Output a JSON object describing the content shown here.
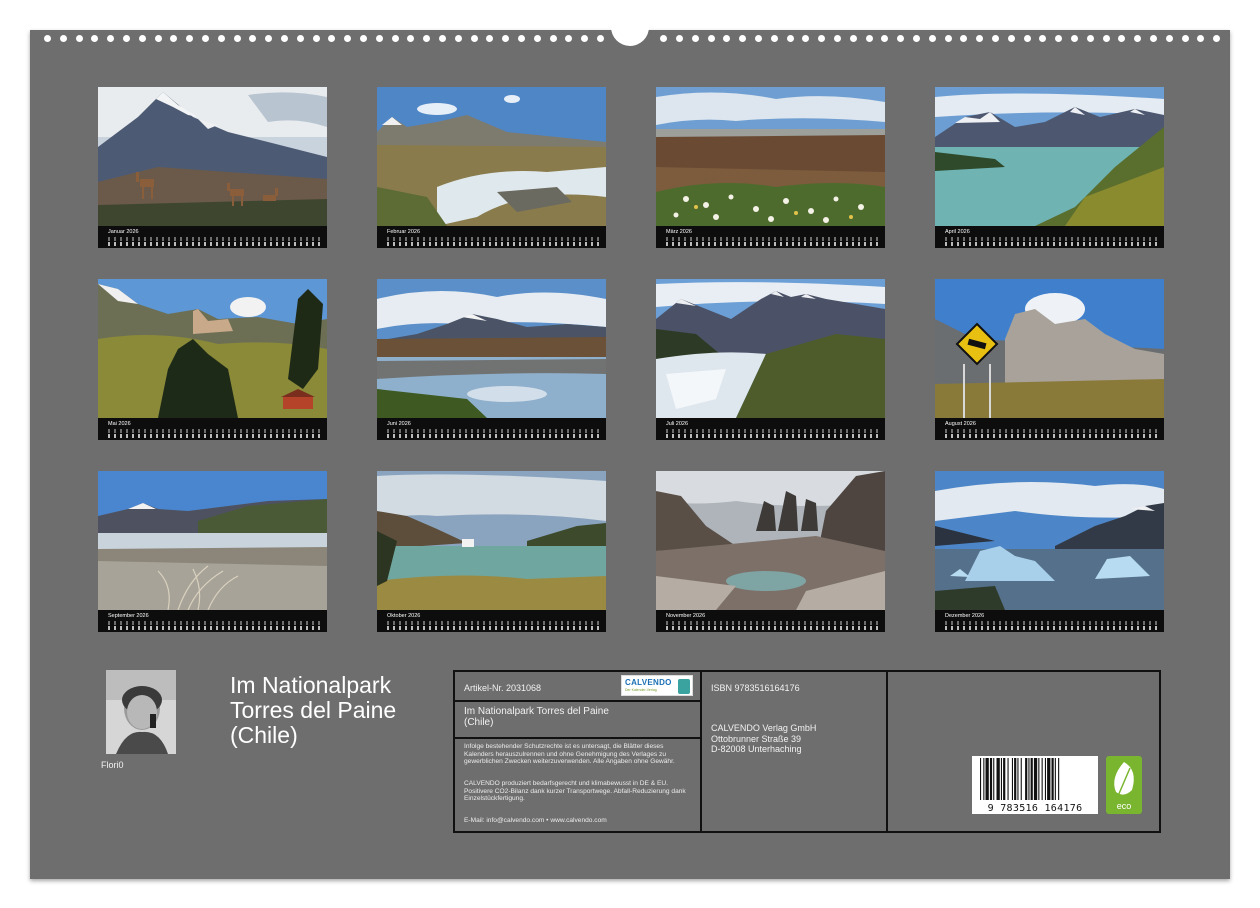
{
  "months": [
    {
      "name": "Januar 2026",
      "scene": "mountain-guanaco"
    },
    {
      "name": "Februar 2026",
      "scene": "waterfall"
    },
    {
      "name": "März 2026",
      "scene": "steppe-flowers"
    },
    {
      "name": "April 2026",
      "scene": "turquoise-lake"
    },
    {
      "name": "Mai 2026",
      "scene": "forest-hut"
    },
    {
      "name": "Juni 2026",
      "scene": "lake-reflection"
    },
    {
      "name": "Juli 2026",
      "scene": "rapids-towers"
    },
    {
      "name": "August 2026",
      "scene": "warning-sign"
    },
    {
      "name": "September 2026",
      "scene": "beach-grass"
    },
    {
      "name": "Oktober 2026",
      "scene": "green-lake"
    },
    {
      "name": "November 2026",
      "scene": "towers-lagoon"
    },
    {
      "name": "Dezember 2026",
      "scene": "icebergs"
    }
  ],
  "author": {
    "name": "Flori0"
  },
  "title": {
    "line1": "Im Nationalpark",
    "line2": "Torres del Paine",
    "line3": "(Chile)"
  },
  "info": {
    "article_no": "Artikel-Nr. 2031068",
    "logo_word": "CALVENDO",
    "logo_tagline": "Der Kalender-Verlag",
    "subtitle_1": "Im Nationalpark Torres del Paine",
    "subtitle_2": "(Chile)",
    "notice_1": "Infolge bestehender Schutzrechte ist es untersagt, die Blätter dieses Kalenders herauszulrennen und ohne Genehmigung des Verlages zu gewerblichen Zwecken weiterzuverwenden. Alle Angaben ohne Gewähr.",
    "notice_2": "CALVENDO produziert bedarfsgerecht und klimabewusst in DE & EU. Positivere CO2-Bilanz dank kurzer Transportwege. Abfall-Reduzierung dank Einzelstückfertigung.",
    "notice_3": "E-Mail: info@calvendo.com • www.calvendo.com",
    "isbn": "ISBN 9783516164176",
    "publisher_1": "CALVENDO Verlag GmbH",
    "publisher_2": "Ottobrunner Straße 39",
    "publisher_3": "D-82008 Unterhaching",
    "barcode_digits": "9 783516 164176",
    "eco_label": "eco"
  },
  "colors": {
    "sheet": "#6e6e6e",
    "calendar_strip": "#0d0d0d",
    "eco_green": "#7ab52f",
    "calvendo_blue": "#1a6fb5"
  }
}
